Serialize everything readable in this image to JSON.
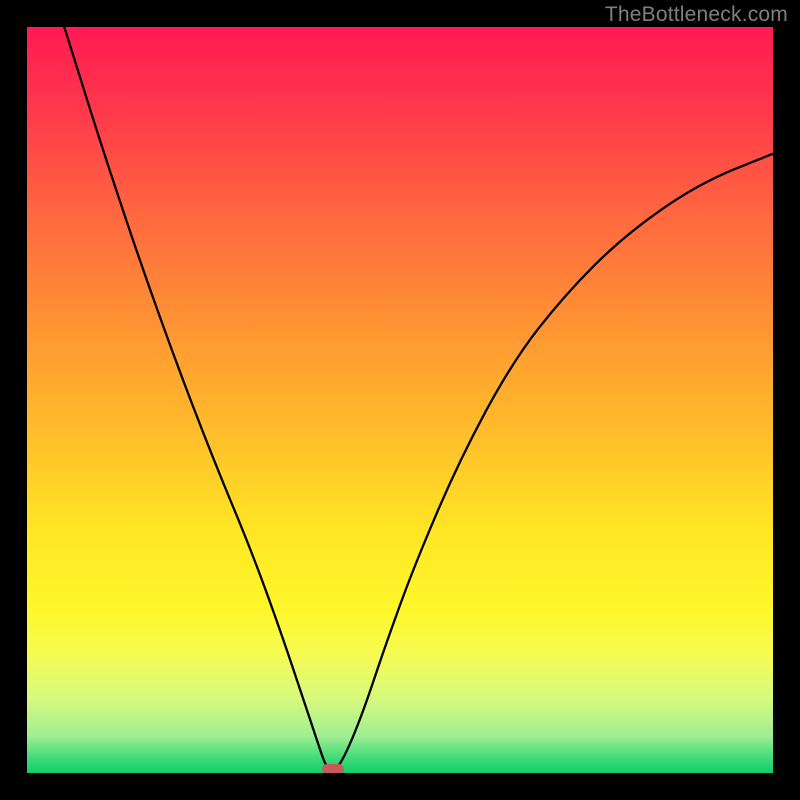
{
  "watermark": "TheBottleneck.com",
  "chart_data": {
    "type": "line",
    "title": "",
    "xlabel": "",
    "ylabel": "",
    "xlim": [
      0,
      100
    ],
    "ylim": [
      0,
      100
    ],
    "series": [
      {
        "name": "curve",
        "x": [
          5,
          10,
          15,
          20,
          25,
          30,
          34,
          37,
          39,
          40,
          41,
          42.5,
          45,
          48,
          52,
          58,
          65,
          72,
          80,
          90,
          100
        ],
        "y": [
          100,
          84,
          69,
          55,
          42,
          30,
          19,
          10,
          4,
          1,
          0,
          2,
          8,
          17,
          28,
          42,
          55,
          64,
          72,
          79,
          83
        ]
      }
    ],
    "marker": {
      "x": 41,
      "y": 0.5,
      "color": "#c95a5a"
    },
    "gradient_stops": [
      {
        "pos": 0,
        "color": "#ff1a54"
      },
      {
        "pos": 55,
        "color": "#ffbf2a"
      },
      {
        "pos": 78,
        "color": "#fef72a"
      },
      {
        "pos": 100,
        "color": "#0fcf67"
      }
    ]
  }
}
